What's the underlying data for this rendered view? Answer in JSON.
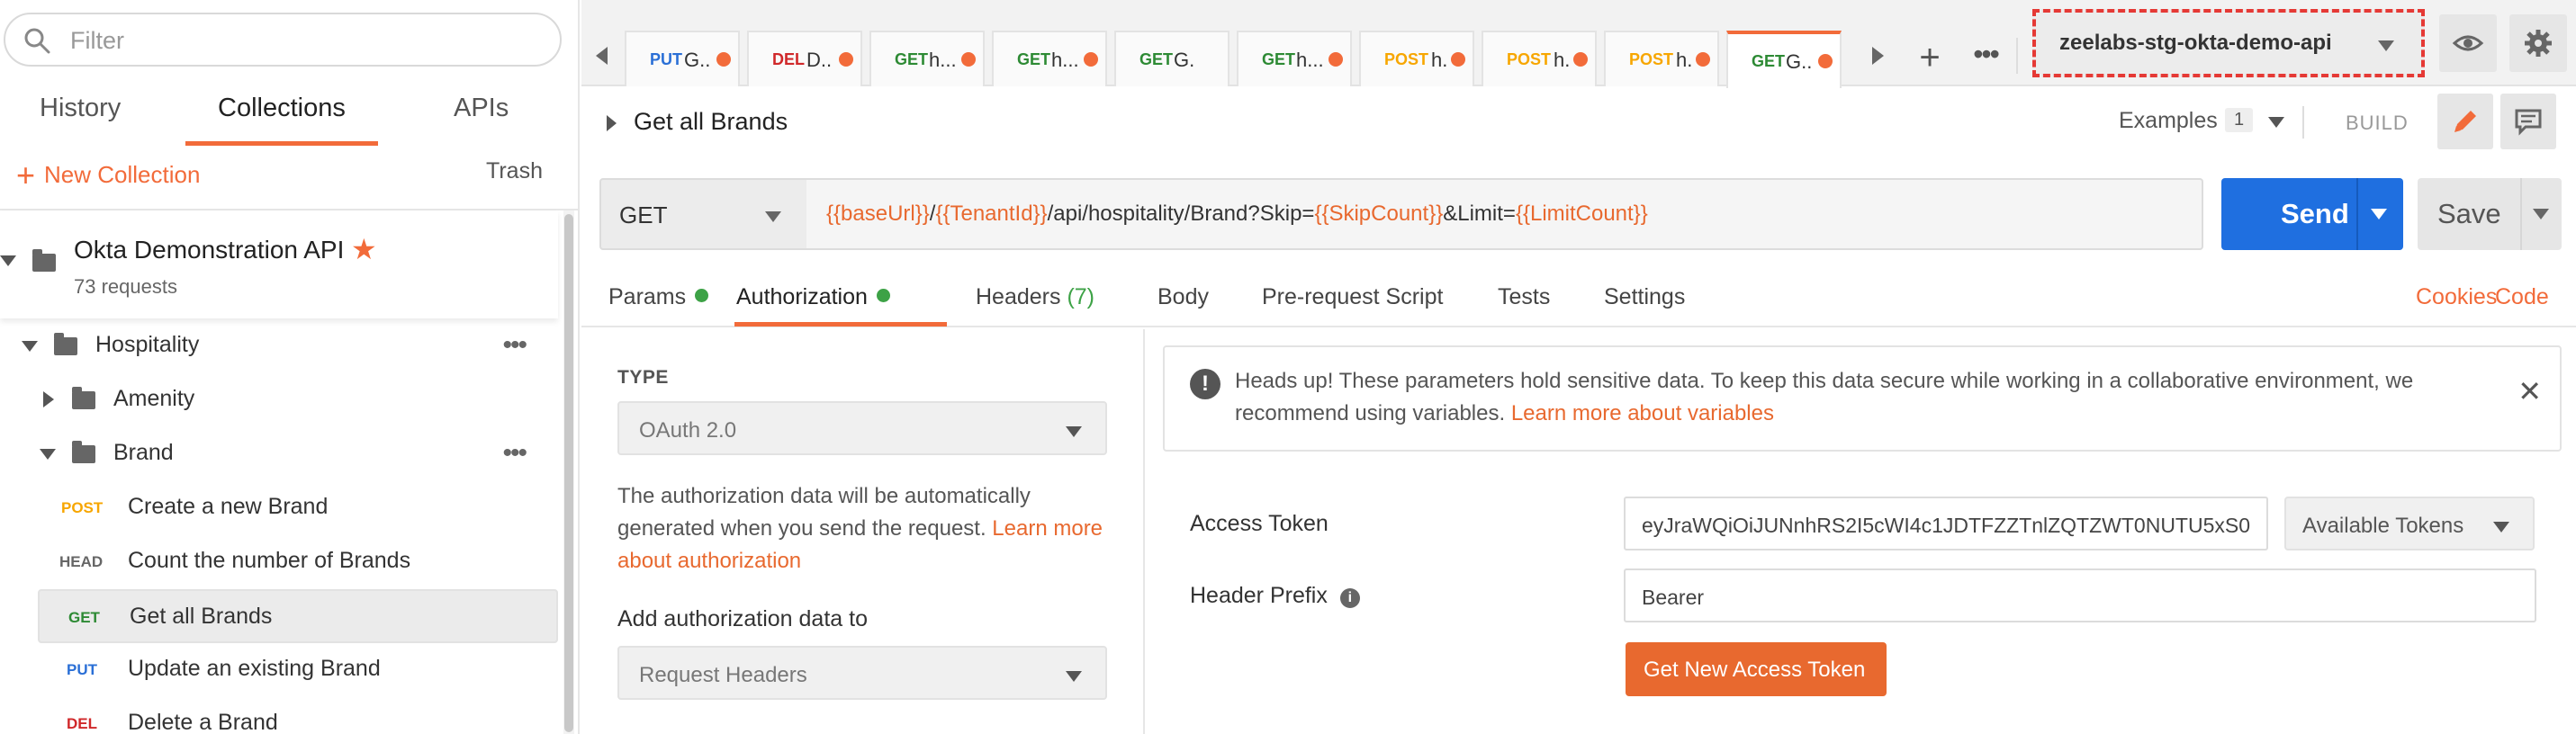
{
  "sidebar": {
    "filter_placeholder": "Filter",
    "tabs": {
      "history": "History",
      "collections": "Collections",
      "apis": "APIs"
    },
    "new_collection": "New Collection",
    "trash": "Trash",
    "collection": {
      "name": "Okta Demonstration API",
      "count": "73 requests"
    },
    "tree": {
      "hospitality": "Hospitality",
      "amenity": "Amenity",
      "brand": "Brand",
      "requests": [
        {
          "method": "POST",
          "name": "Create a new Brand"
        },
        {
          "method": "HEAD",
          "name": "Count the number of Brands"
        },
        {
          "method": "GET",
          "name": "Get all Brands"
        },
        {
          "method": "PUT",
          "name": "Update an existing Brand"
        },
        {
          "method": "DEL",
          "name": "Delete a Brand"
        }
      ]
    }
  },
  "tabstrip": {
    "tabs": [
      {
        "method": "PUT",
        "title": "G..",
        "dirty": true
      },
      {
        "method": "DEL",
        "title": "D..",
        "dirty": true
      },
      {
        "method": "GET",
        "title": "h...",
        "dirty": true
      },
      {
        "method": "GET",
        "title": "h...",
        "dirty": true
      },
      {
        "method": "GET",
        "title": "G.",
        "dirty": false
      },
      {
        "method": "GET",
        "title": "h...",
        "dirty": true
      },
      {
        "method": "POST",
        "title": "h.",
        "dirty": true
      },
      {
        "method": "POST",
        "title": "h.",
        "dirty": true
      },
      {
        "method": "POST",
        "title": "h.",
        "dirty": true
      },
      {
        "method": "GET",
        "title": "G..",
        "dirty": true
      }
    ],
    "environment": "zeelabs-stg-okta-demo-api"
  },
  "request": {
    "name": "Get all Brands",
    "examples_label": "Examples",
    "examples_count": "1",
    "build_label": "BUILD",
    "method": "GET",
    "url_parts": [
      {
        "t": "var",
        "v": "{{baseUrl}}"
      },
      {
        "t": "lit",
        "v": "/"
      },
      {
        "t": "var",
        "v": "{{TenantId}}"
      },
      {
        "t": "lit",
        "v": "/api/hospitality/Brand?Skip="
      },
      {
        "t": "var",
        "v": "{{SkipCount}}"
      },
      {
        "t": "lit",
        "v": "&Limit="
      },
      {
        "t": "var",
        "v": "{{LimitCount}}"
      }
    ],
    "send_label": "Send",
    "save_label": "Save"
  },
  "req_tabs": {
    "params": "Params",
    "authorization": "Authorization",
    "headers": "Headers",
    "headers_count": "(7)",
    "body": "Body",
    "prerequest": "Pre-request Script",
    "tests": "Tests",
    "settings": "Settings",
    "cookies": "Cookies",
    "code": "Code"
  },
  "auth": {
    "type_label": "TYPE",
    "type_value": "OAuth 2.0",
    "desc_text": "The authorization data will be automatically generated when you send the request. ",
    "desc_link": "Learn more about authorization",
    "add_to_label": "Add authorization data to",
    "add_to_value": "Request Headers",
    "alert_text": "Heads up! These parameters hold sensitive data. To keep this data secure while working in a collaborative environment, we recommend using variables. ",
    "alert_link": "Learn more about variables",
    "access_token_label": "Access Token",
    "access_token_value": "eyJraWQiOiJUNnhRS2I5cWI4c1JDTFZZTnlZQTZWT0NUTU5xS0",
    "available_tokens": "Available Tokens",
    "header_prefix_label": "Header Prefix",
    "header_prefix_value": "Bearer",
    "get_new_token": "Get New Access Token"
  },
  "colors": {
    "accent": "#f26b3a",
    "send": "#1f6fe0",
    "method_get": "#2d8a34",
    "method_post": "#f7a600",
    "method_put": "#2a6fd6",
    "method_del": "#d0282a",
    "method_head": "#666666"
  }
}
